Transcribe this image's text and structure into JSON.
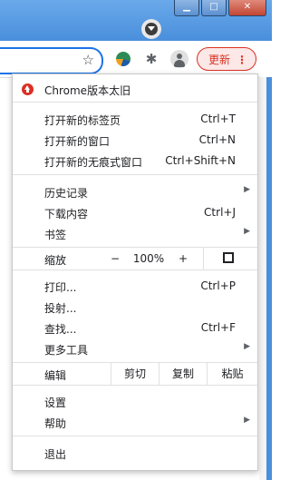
{
  "window": {
    "minimize_glyph": "▁",
    "maximize_glyph": "□",
    "close_glyph": "✕"
  },
  "toolbar": {
    "update_label": "更新",
    "menu_glyph": "⋮",
    "star_glyph": "☆",
    "puzzle_glyph": "✱"
  },
  "menu": {
    "update_notice": "Chrome版本太旧",
    "new_tab": {
      "label": "打开新的标签页",
      "shortcut": "Ctrl+T"
    },
    "new_window": {
      "label": "打开新的窗口",
      "shortcut": "Ctrl+N"
    },
    "new_incognito": {
      "label": "打开新的无痕式窗口",
      "shortcut": "Ctrl+Shift+N"
    },
    "history": {
      "label": "历史记录"
    },
    "downloads": {
      "label": "下载内容",
      "shortcut": "Ctrl+J"
    },
    "bookmarks": {
      "label": "书签"
    },
    "zoom": {
      "label": "缩放",
      "minus": "−",
      "value": "100%",
      "plus": "+"
    },
    "print": {
      "label": "打印...",
      "shortcut": "Ctrl+P"
    },
    "cast": {
      "label": "投射..."
    },
    "find": {
      "label": "查找...",
      "shortcut": "Ctrl+F"
    },
    "more_tools": {
      "label": "更多工具"
    },
    "edit": {
      "label": "编辑",
      "cut": "剪切",
      "copy": "复制",
      "paste": "粘贴"
    },
    "settings": {
      "label": "设置"
    },
    "help": {
      "label": "帮助"
    },
    "exit": {
      "label": "退出"
    }
  },
  "colors": {
    "accent": "#1a73e8",
    "update_red": "#d93025",
    "title_bar": "#4a8fdc"
  }
}
